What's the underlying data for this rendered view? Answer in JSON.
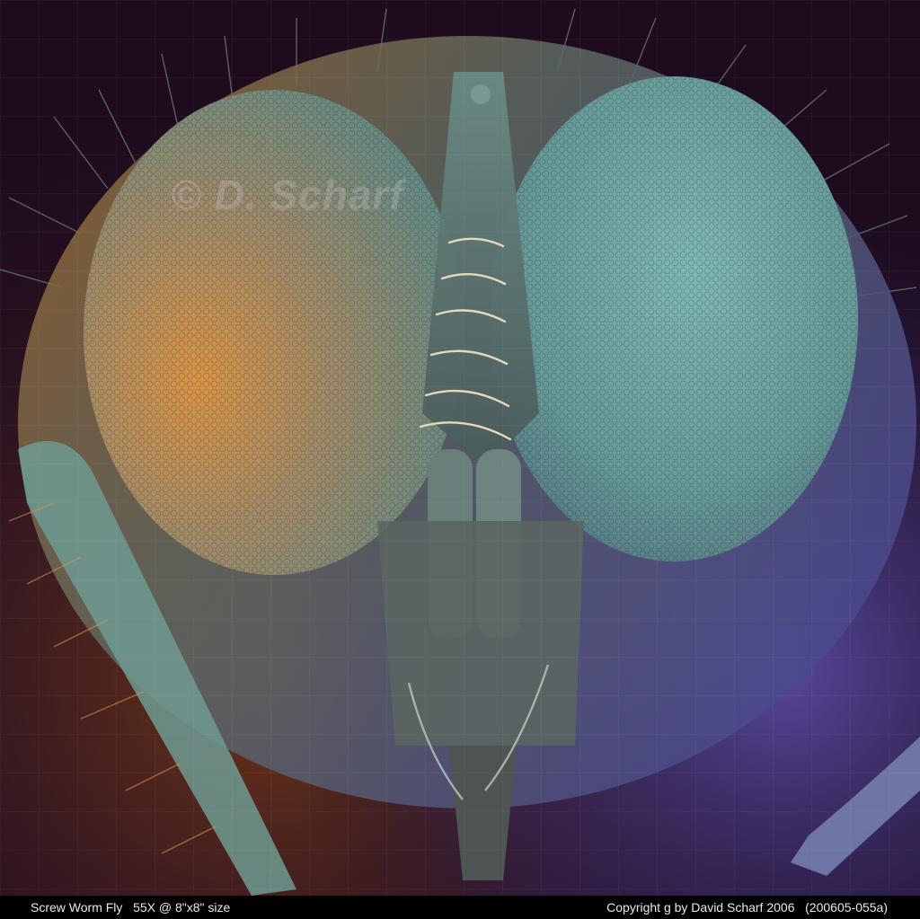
{
  "watermark": {
    "text": "© D. Scharf"
  },
  "caption": {
    "left": "Screw Worm Fly   55X @ 8\"x8\" size",
    "right": "Copyright g by David Scharf 2006   (200605-055a)"
  },
  "colors": {
    "background": "#2a1228",
    "eye_left_warm": "#c8843a",
    "eye_right_cool": "#6fa6a2",
    "shadow_purple": "#5a4aa0",
    "caption_bar": "#000000"
  }
}
